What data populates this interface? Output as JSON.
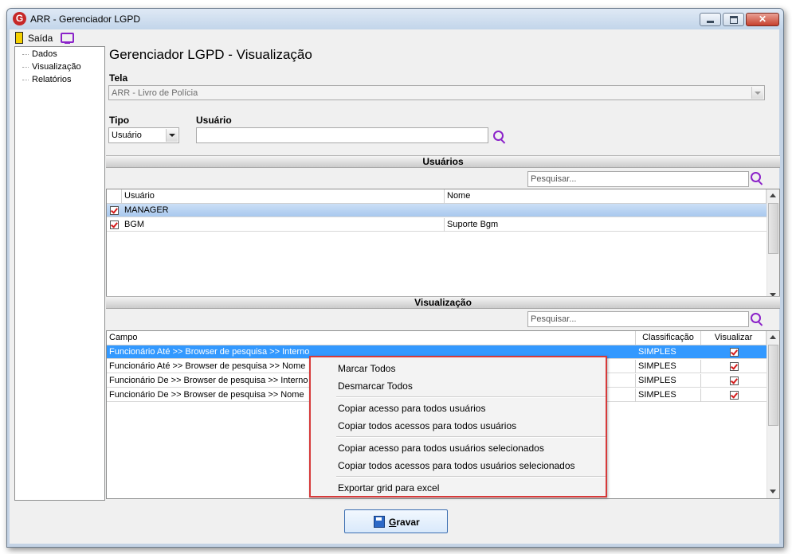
{
  "window": {
    "title": "ARR - Gerenciador LGPD",
    "icon": "app-logo-icon"
  },
  "toolbar": {
    "exit_label": "Saída"
  },
  "tree": {
    "items": [
      "Dados",
      "Visualização",
      "Relatórios"
    ]
  },
  "page_title": "Gerenciador LGPD - Visualização",
  "form": {
    "tela_label": "Tela",
    "tela_value": "ARR - Livro de Polícia",
    "tipo_label": "Tipo",
    "tipo_value": "Usuário",
    "usuario_label": "Usuário",
    "usuario_value": ""
  },
  "usuarios_section": {
    "title": "Usuários",
    "search_placeholder": "Pesquisar...",
    "columns": [
      "Usuário",
      "Nome"
    ],
    "rows": [
      {
        "checked": true,
        "usuario": "MANAGER",
        "nome": ""
      },
      {
        "checked": true,
        "usuario": "BGM",
        "nome": "Suporte Bgm"
      }
    ]
  },
  "visualizacao_section": {
    "title": "Visualização",
    "search_placeholder": "Pesquisar...",
    "columns": [
      "Campo",
      "Classificação",
      "Visualizar"
    ],
    "rows": [
      {
        "campo": "Funcionário Até >> Browser de pesquisa >> Interno",
        "classificacao": "SIMPLES",
        "visualizar": true
      },
      {
        "campo": "Funcionário Até >> Browser de pesquisa >> Nome",
        "classificacao": "SIMPLES",
        "visualizar": true
      },
      {
        "campo": "Funcionário De >> Browser de pesquisa >> Interno",
        "classificacao": "SIMPLES",
        "visualizar": true
      },
      {
        "campo": "Funcionário De >> Browser de pesquisa >> Nome",
        "classificacao": "SIMPLES",
        "visualizar": true
      }
    ]
  },
  "context_menu": {
    "items": [
      "Marcar Todos",
      "Desmarcar Todos",
      "Copiar acesso para todos usuários",
      "Copiar todos acessos para todos usuários",
      "Copiar acesso para todos usuários selecionados",
      "Copiar todos acessos para todos usuários selecionados",
      "Exportar grid para excel"
    ]
  },
  "footer": {
    "save_label": "Gravar"
  },
  "colors": {
    "accent": "#8b22c9",
    "selection": "#3399ff",
    "menu_border": "#d63a3a",
    "check": "#d41a1a"
  }
}
